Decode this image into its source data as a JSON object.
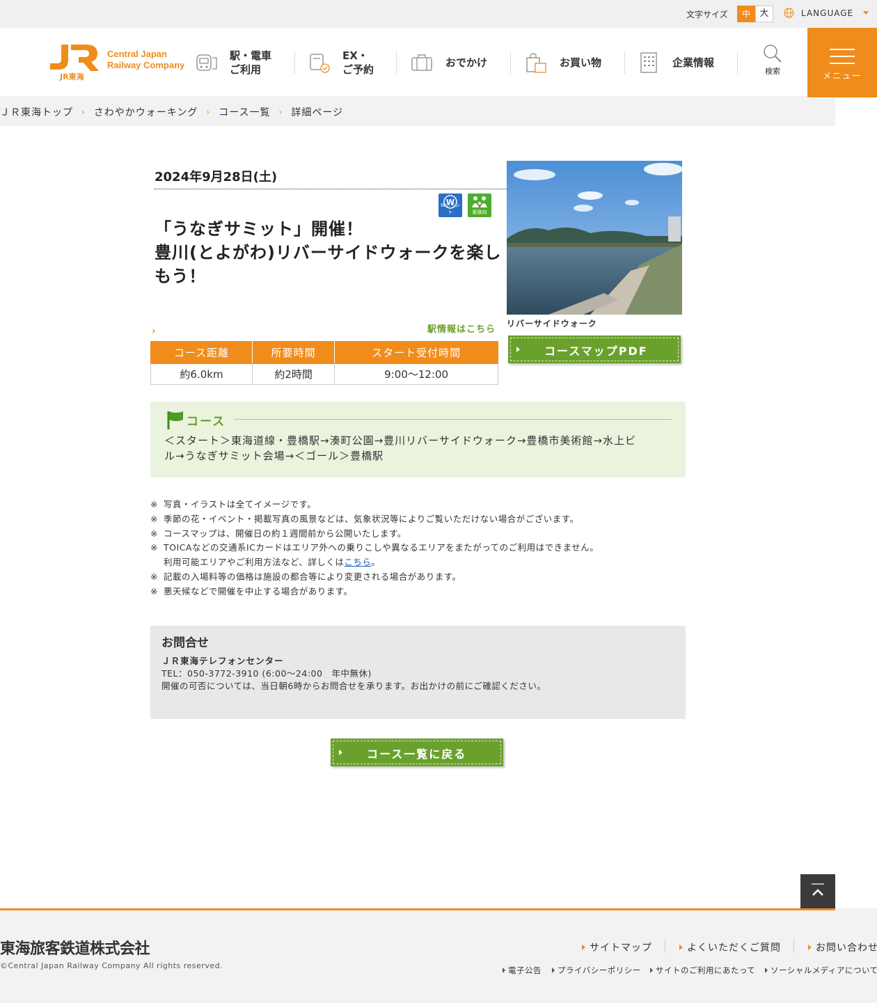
{
  "utility": {
    "font_size_label": "文字サイズ",
    "font_size_mid": "中",
    "font_size_large": "大",
    "language_label": "LANGUAGE"
  },
  "header": {
    "logo_sub": "JR東海",
    "logo_line1": "Central Japan",
    "logo_line2": "Railway Company",
    "nav": [
      {
        "line1": "駅・電車",
        "line2": "ご利用"
      },
      {
        "line1": "EX・",
        "line2": "ご予約"
      },
      {
        "line1": "おでかけ",
        "line2": ""
      },
      {
        "line1": "お買い物",
        "line2": ""
      },
      {
        "line1": "企業情報",
        "line2": ""
      }
    ],
    "search_label": "検索",
    "menu_label": "メニュー"
  },
  "breadcrumb": [
    "ＪＲ東海トップ",
    "さわやかウォーキング",
    "コース一覧",
    "詳細ページ"
  ],
  "event": {
    "date": "2024年9月28日(土)",
    "badges": [
      {
        "icon": "w-point-icon",
        "label": "Wポイント"
      },
      {
        "icon": "family-icon",
        "label": "家族向"
      }
    ],
    "title_line1": "「うなぎサミット」開催！",
    "title_line2": "豊川(とよがわ)リバーサイドウォークを楽し",
    "title_line3": "もう！",
    "station_link": "駅情報はこちら",
    "table": {
      "headers": [
        "コース距離",
        "所要時間",
        "スタート受付時間"
      ],
      "values": [
        "約6.0km",
        "約2時間",
        "9:00～12:00"
      ]
    },
    "photo_caption": "リバーサイドウォーク",
    "pdf_button": "コースマップPDF"
  },
  "course": {
    "title": "コース",
    "line1": "＜スタート＞東海道線・豊橋駅→湊町公園→豊川リバーサイドウォーク→豊橋市美術館→水上ビ",
    "line2": "ル→うなぎサミット会場→＜ゴール＞豊橋駅"
  },
  "notes": {
    "mark": "※",
    "n1": "写真・イラストは全てイメージです。",
    "n2": "季節の花・イベント・掲載写真の風景などは、気象状況等によりご覧いただけない場合がございます。",
    "n3": "コースマップは、開催日の約１週間前から公開いたします。",
    "n4": "TOICAなどの交通系ICカードはエリア外への乗りこしや異なるエリアをまたがってのご利用はできません。",
    "n4b_pre": "利用可能エリアやご利用方法など、詳しくは",
    "n4b_link": "こちら",
    "n4b_post": "。",
    "n5": "記載の入場料等の価格は施設の都合等により変更される場合があります。",
    "n6": "悪天候などで開催を中止する場合があります。"
  },
  "contact": {
    "title": "お問合せ",
    "name": "ＪＲ東海テレフォンセンター",
    "tel": "TEL：050-3772-3910 (6:00～24:00　年中無休)",
    "note": "開催の可否については、当日朝6時からお問合せを承ります。お出かけの前にご確認ください。"
  },
  "back_button": "コース一覧に戻る",
  "footer": {
    "company": "東海旅客鉄道株式会社",
    "copyright": "©Central Japan Railway Company All rights reserved.",
    "main_links": [
      "サイトマップ",
      "よくいただくご質問",
      "お問い合わせ"
    ],
    "sub_links": [
      "電子公告",
      "プライバシーポリシー",
      "サイトのご利用にあたって",
      "ソーシャルメディアについて"
    ]
  },
  "colors": {
    "brand_orange": "#f08c1c",
    "green": "#6aa12d",
    "course_bg": "#eaf3de"
  }
}
